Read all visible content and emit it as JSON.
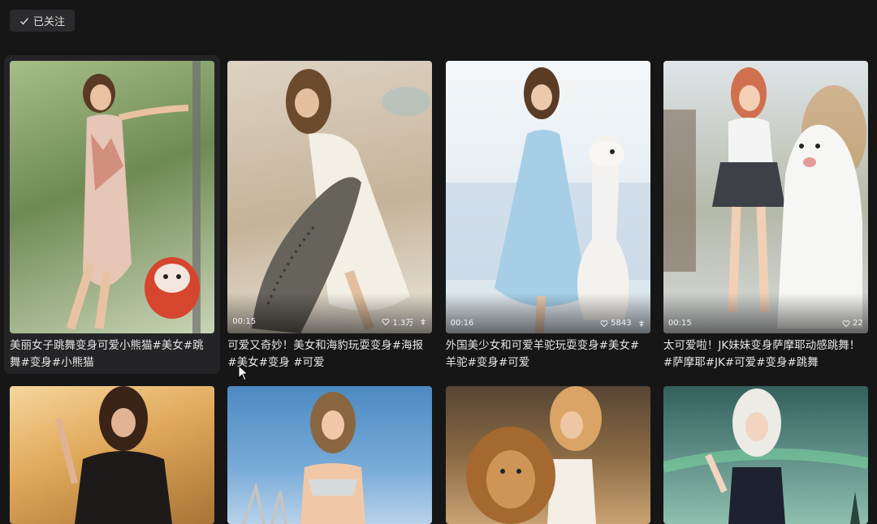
{
  "follow_button": {
    "label": "已关注",
    "icon": "check-icon"
  },
  "cards": [
    {
      "duration": "",
      "likes": "",
      "caption": "美丽女子跳舞变身可爱小熊猫#美女#跳舞#变身#小熊猫",
      "colors": [
        "#9bb27c",
        "#6a7f51",
        "#d0d6bd"
      ]
    },
    {
      "duration": "00:15",
      "likes": "1.3万",
      "caption": "可爱又奇妙！美女和海豹玩耍变身#海报#美女#变身 #可爱",
      "colors": [
        "#d9cfbe",
        "#c3b49b",
        "#e8e4da"
      ]
    },
    {
      "duration": "00:16",
      "likes": "5843",
      "caption": "外国美少女和可爱羊驼玩耍变身#美女#羊驼#变身#可爱",
      "colors": [
        "#eef3f7",
        "#b8d4e8",
        "#dfe9f0"
      ]
    },
    {
      "duration": "00:15",
      "likes": "22",
      "caption": "太可爱啦！JK妹妹变身萨摩耶动感跳舞！#萨摩耶#JK#可爱#变身#跳舞",
      "colors": [
        "#c8cfd6",
        "#9aa39a",
        "#e6e8ea"
      ]
    },
    {
      "duration": "",
      "likes": "",
      "caption": "",
      "colors": [
        "#e0a85a",
        "#b07838",
        "#f5d19a"
      ]
    },
    {
      "duration": "",
      "likes": "",
      "caption": "",
      "colors": [
        "#5f95c9",
        "#8ab6de",
        "#c5dbef"
      ]
    },
    {
      "duration": "",
      "likes": "",
      "caption": "",
      "colors": [
        "#8a6a44",
        "#c79a63",
        "#e8c79a"
      ]
    },
    {
      "duration": "",
      "likes": "",
      "caption": "",
      "colors": [
        "#3f6e6a",
        "#6a9a92",
        "#9cc7b8"
      ]
    }
  ]
}
